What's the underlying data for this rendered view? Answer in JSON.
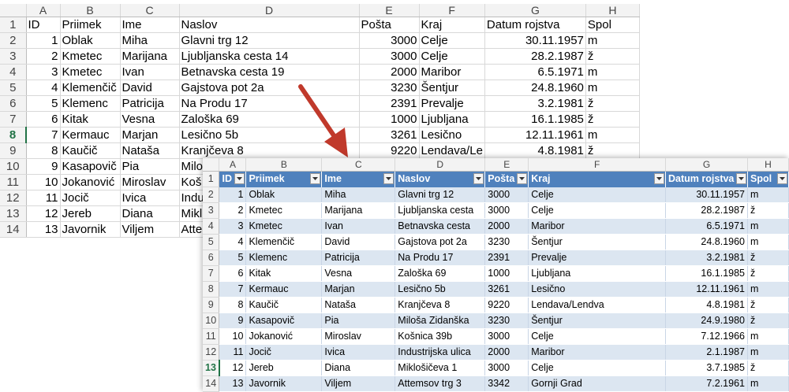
{
  "columns": [
    "A",
    "B",
    "C",
    "D",
    "E",
    "F",
    "G",
    "H"
  ],
  "back": {
    "row_numbers": [
      "1",
      "2",
      "3",
      "4",
      "5",
      "6",
      "7",
      "8",
      "9",
      "10",
      "11",
      "12",
      "13",
      "14"
    ],
    "selected_row": "8",
    "header": [
      "ID",
      "Priimek",
      "Ime",
      "Naslov",
      "Pošta",
      "Kraj",
      "Datum rojstva",
      "Spol"
    ],
    "rows": [
      [
        "1",
        "Oblak",
        "Miha",
        "Glavni trg 12",
        "3000",
        "Celje",
        "30.11.1957",
        "m"
      ],
      [
        "2",
        "Kmetec",
        "Marijana",
        "Ljubljanska cesta 14",
        "3000",
        "Celje",
        "28.2.1987",
        "ž"
      ],
      [
        "3",
        "Kmetec",
        "Ivan",
        "Betnavska cesta 19",
        "2000",
        "Maribor",
        "6.5.1971",
        "m"
      ],
      [
        "4",
        "Klemenčič",
        "David",
        "Gajstova pot 2a",
        "3230",
        "Šentjur",
        "24.8.1960",
        "m"
      ],
      [
        "5",
        "Klemenc",
        "Patricija",
        "Na Produ 17",
        "2391",
        "Prevalje",
        "3.2.1981",
        "ž"
      ],
      [
        "6",
        "Kitak",
        "Vesna",
        "Zaloška 69",
        "1000",
        "Ljubljana",
        "16.1.1985",
        "ž"
      ],
      [
        "7",
        "Kermauc",
        "Marjan",
        "Lesično 5b",
        "3261",
        "Lesično",
        "12.11.1961",
        "m"
      ],
      [
        "8",
        "Kaučič",
        "Nataša",
        "Kranjčeva 8",
        "9220",
        "Lendava/Le",
        "4.8.1981",
        "ž"
      ],
      [
        "9",
        "Kasapovič",
        "Pia",
        "Milo",
        "",
        "",
        "",
        ""
      ],
      [
        "10",
        "Jokanović",
        "Miroslav",
        "Koš",
        "",
        "",
        "",
        ""
      ],
      [
        "11",
        "Jocič",
        "Ivica",
        "Indu",
        "",
        "",
        "",
        ""
      ],
      [
        "12",
        "Jereb",
        "Diana",
        "Mikl",
        "",
        "",
        "",
        ""
      ],
      [
        "13",
        "Javornik",
        "Viljem",
        "Atte",
        "",
        "",
        "",
        ""
      ]
    ]
  },
  "front": {
    "row_numbers": [
      "1",
      "2",
      "3",
      "4",
      "5",
      "6",
      "7",
      "8",
      "9",
      "10",
      "11",
      "12",
      "13",
      "14"
    ],
    "selected_row": "13",
    "header": [
      "ID",
      "Priimek",
      "Ime",
      "Naslov",
      "Pošta",
      "Kraj",
      "Datum rojstva",
      "Spol"
    ],
    "rows": [
      [
        "1",
        "Oblak",
        "Miha",
        "Glavni trg 12",
        "3000",
        "Celje",
        "30.11.1957",
        "m"
      ],
      [
        "2",
        "Kmetec",
        "Marijana",
        "Ljubljanska cesta",
        "3000",
        "Celje",
        "28.2.1987",
        "ž"
      ],
      [
        "3",
        "Kmetec",
        "Ivan",
        "Betnavska cesta",
        "2000",
        "Maribor",
        "6.5.1971",
        "m"
      ],
      [
        "4",
        "Klemenčič",
        "David",
        "Gajstova pot 2a",
        "3230",
        "Šentjur",
        "24.8.1960",
        "m"
      ],
      [
        "5",
        "Klemenc",
        "Patricija",
        "Na Produ 17",
        "2391",
        "Prevalje",
        "3.2.1981",
        "ž"
      ],
      [
        "6",
        "Kitak",
        "Vesna",
        "Zaloška 69",
        "1000",
        "Ljubljana",
        "16.1.1985",
        "ž"
      ],
      [
        "7",
        "Kermauc",
        "Marjan",
        "Lesično 5b",
        "3261",
        "Lesično",
        "12.11.1961",
        "m"
      ],
      [
        "8",
        "Kaučič",
        "Nataša",
        "Kranjčeva 8",
        "9220",
        "Lendava/Lendva",
        "4.8.1981",
        "ž"
      ],
      [
        "9",
        "Kasapovič",
        "Pia",
        "Miloša Zidanška",
        "3230",
        "Šentjur",
        "24.9.1980",
        "ž"
      ],
      [
        "10",
        "Jokanović",
        "Miroslav",
        "Košnica 39b",
        "3000",
        "Celje",
        "7.12.1966",
        "m"
      ],
      [
        "11",
        "Jocič",
        "Ivica",
        "Industrijska ulica",
        "2000",
        "Maribor",
        "2.1.1987",
        "m"
      ],
      [
        "12",
        "Jereb",
        "Diana",
        "Miklošičeva 1",
        "3000",
        "Celje",
        "3.7.1985",
        "ž"
      ],
      [
        "13",
        "Javornik",
        "Viljem",
        "Attemsov trg 3",
        "3342",
        "Gornji Grad",
        "7.2.1961",
        "m"
      ]
    ]
  },
  "colors": {
    "table_header": "#4f81bd",
    "band": "#dce6f1",
    "selected_row_header": "#217346",
    "arrow": "#c0392b"
  }
}
